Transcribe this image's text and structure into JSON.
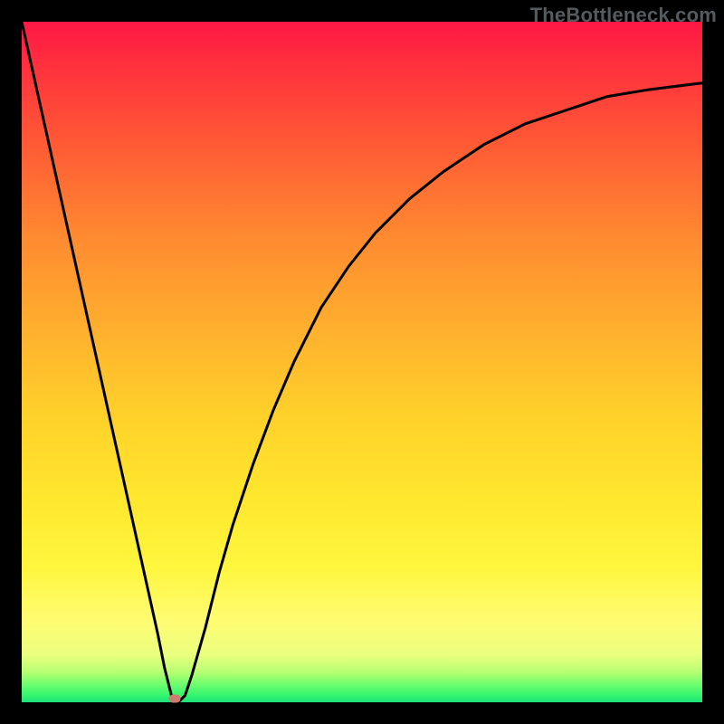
{
  "watermark": "TheBottleneck.com",
  "chart_data": {
    "type": "line",
    "title": "",
    "xlabel": "",
    "ylabel": "",
    "xlim": [
      0,
      100
    ],
    "ylim": [
      0,
      100
    ],
    "x": [
      0,
      2,
      4,
      6,
      8,
      10,
      12,
      14,
      16,
      18,
      20,
      21,
      22,
      23,
      24,
      25,
      27,
      29,
      31,
      34,
      37,
      40,
      44,
      48,
      52,
      57,
      62,
      68,
      74,
      80,
      86,
      92,
      100
    ],
    "y": [
      100,
      91,
      82,
      73,
      64,
      55,
      46,
      37,
      28,
      19,
      10,
      5,
      1,
      0,
      1,
      4,
      11,
      19,
      26,
      35,
      43,
      50,
      58,
      64,
      69,
      74,
      78,
      82,
      85,
      87,
      89,
      90,
      91
    ],
    "marker": {
      "x": 22.5,
      "y": 0.5
    },
    "gradient_stops": [
      {
        "pct": 0,
        "color": "#ff1745"
      },
      {
        "pct": 18,
        "color": "#ff5a35"
      },
      {
        "pct": 46,
        "color": "#ffb22e"
      },
      {
        "pct": 70,
        "color": "#ffe72e"
      },
      {
        "pct": 88,
        "color": "#fffc72"
      },
      {
        "pct": 97,
        "color": "#7cff6e"
      },
      {
        "pct": 100,
        "color": "#1de07c"
      }
    ]
  }
}
